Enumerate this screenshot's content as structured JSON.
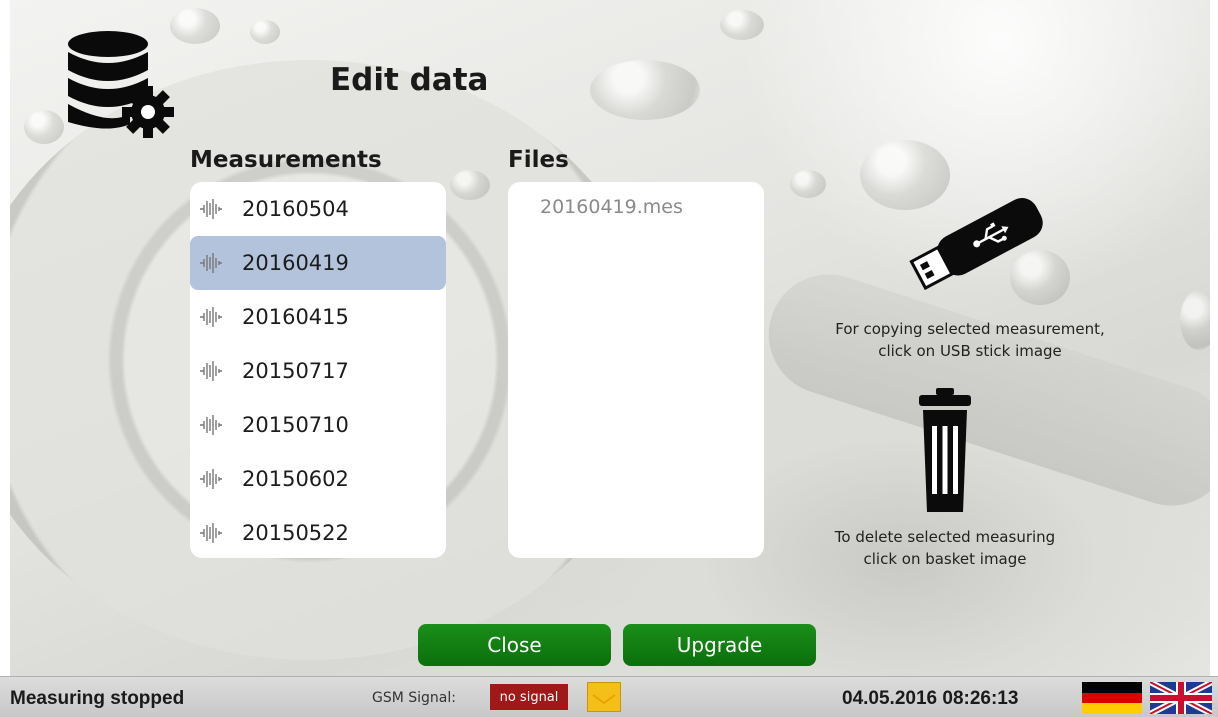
{
  "title": "Edit data",
  "columns": {
    "measurements": "Measurements",
    "files": "Files"
  },
  "measurements": [
    {
      "label": "20160504",
      "selected": false
    },
    {
      "label": "20160419",
      "selected": true
    },
    {
      "label": "20160415",
      "selected": false
    },
    {
      "label": "20150717",
      "selected": false
    },
    {
      "label": "20150710",
      "selected": false
    },
    {
      "label": "20150602",
      "selected": false
    },
    {
      "label": "20150522",
      "selected": false
    }
  ],
  "files": [
    "20160419.mes"
  ],
  "hints": {
    "usb_line1": "For copying selected measurement,",
    "usb_line2": "click on USB stick image",
    "trash_line1": "To delete selected measuring",
    "trash_line2": "click on basket image"
  },
  "buttons": {
    "close": "Close",
    "upgrade": "Upgrade"
  },
  "status": {
    "measuring": "Measuring stopped",
    "gsm_label": "GSM Signal:",
    "gsm_value": "no signal",
    "datetime": "04.05.2016 08:26:13"
  },
  "icons": {
    "logo": "database-gear-icon",
    "usb": "usb-stick-icon",
    "trash": "trash-icon",
    "wave": "waveform-icon",
    "message": "envelope-icon",
    "flag_de": "flag-germany-icon",
    "flag_uk": "flag-uk-icon"
  },
  "colors": {
    "button": "#0f7a0f",
    "selected_row": "#b4c3dc",
    "gsm_badge": "#a01818",
    "message_button": "#f5bf1a"
  }
}
